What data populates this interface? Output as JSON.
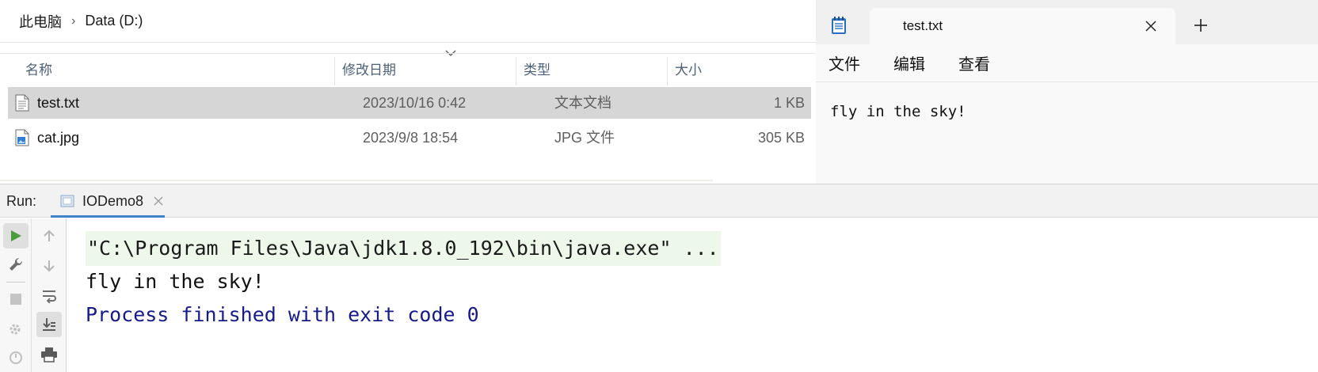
{
  "explorer": {
    "breadcrumb": [
      "此电脑",
      "Data (D:)"
    ],
    "columns": {
      "name": "名称",
      "date": "修改日期",
      "type": "类型",
      "size": "大小"
    },
    "rows": [
      {
        "name": "test.txt",
        "date": "2023/10/16 0:42",
        "type": "文本文档",
        "size": "1 KB",
        "icon": "text-file-icon",
        "selected": true
      },
      {
        "name": "cat.jpg",
        "date": "2023/9/8 18:54",
        "type": "JPG 文件",
        "size": "305 KB",
        "icon": "image-file-icon",
        "selected": false
      }
    ]
  },
  "notepad": {
    "tab_title": "test.txt",
    "menu": [
      "文件",
      "编辑",
      "查看"
    ],
    "content": "fly in the sky!"
  },
  "ide": {
    "run_label": "Run:",
    "config_name": "IODemo8",
    "console": {
      "command": "\"C:\\Program Files\\Java\\jdk1.8.0_192\\bin\\java.exe\" ...",
      "output": "fly in the sky!",
      "exit": "Process finished with exit code 0"
    }
  },
  "colors": {
    "selected_row": "#d6d6d6",
    "command_bg": "#edf7ea",
    "exit_text": "#161a8a",
    "tab_underline": "#4083c9",
    "run_icon": "#4a9c3e"
  }
}
